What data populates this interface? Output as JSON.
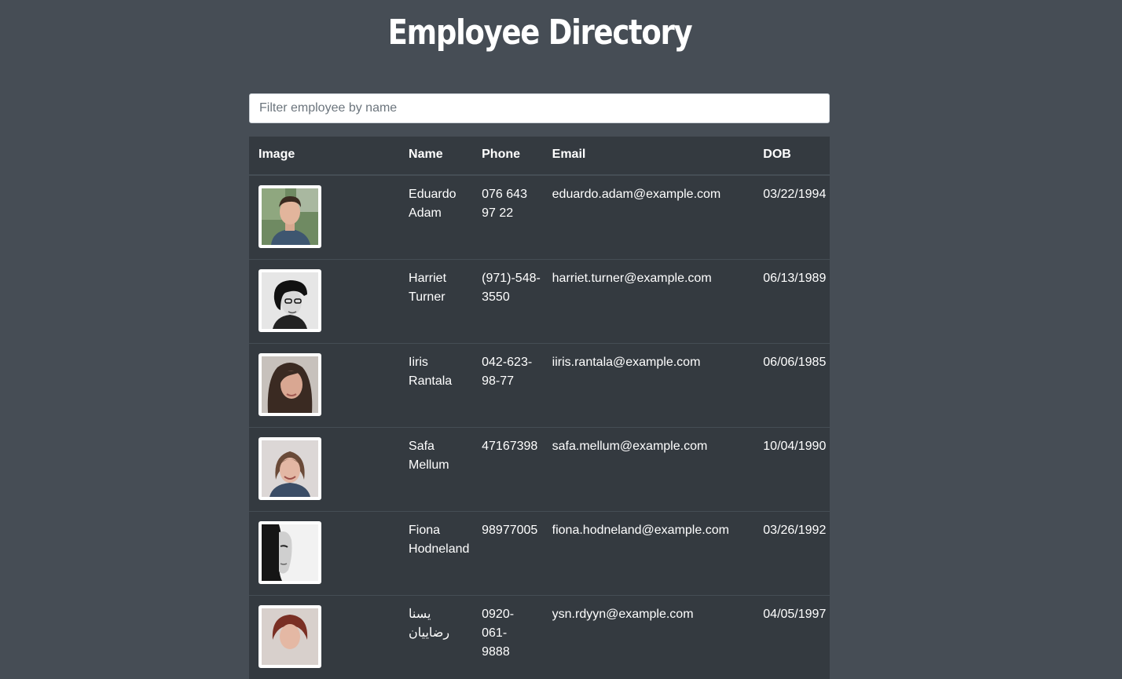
{
  "header": {
    "title": "Employee Directory"
  },
  "search": {
    "placeholder": "Filter employee by name",
    "value": ""
  },
  "table": {
    "columns": [
      "Image",
      "Name",
      "Phone",
      "Email",
      "DOB"
    ],
    "rows": [
      {
        "name": "Eduardo Adam",
        "phone": "076 643 97 22",
        "email": "eduardo.adam@example.com",
        "dob": "03/22/1994",
        "image": "photo-male-outdoor"
      },
      {
        "name": "Harriet Turner",
        "phone": "(971)-548-3550",
        "email": "harriet.turner@example.com",
        "dob": "06/13/1989",
        "image": "photo-female-beanie-bw"
      },
      {
        "name": "Iiris Rantala",
        "phone": "042-623-98-77",
        "email": "iiris.rantala@example.com",
        "dob": "06/06/1985",
        "image": "photo-female-dark-hair"
      },
      {
        "name": "Safa Mellum",
        "phone": "47167398",
        "email": "safa.mellum@example.com",
        "dob": "10/04/1990",
        "image": "photo-female-smiling"
      },
      {
        "name": "Fiona Hodneland",
        "phone": "98977005",
        "email": "fiona.hodneland@example.com",
        "dob": "03/26/1992",
        "image": "photo-female-bw-side"
      },
      {
        "name": "یسنا رضاییان",
        "phone": "0920-061-9888",
        "email": "ysn.rdyyn@example.com",
        "dob": "04/05/1997",
        "image": "photo-female-red-hair"
      }
    ]
  },
  "colors": {
    "page_background": "#464d55",
    "table_background": "#343a40",
    "text": "#ffffff"
  }
}
